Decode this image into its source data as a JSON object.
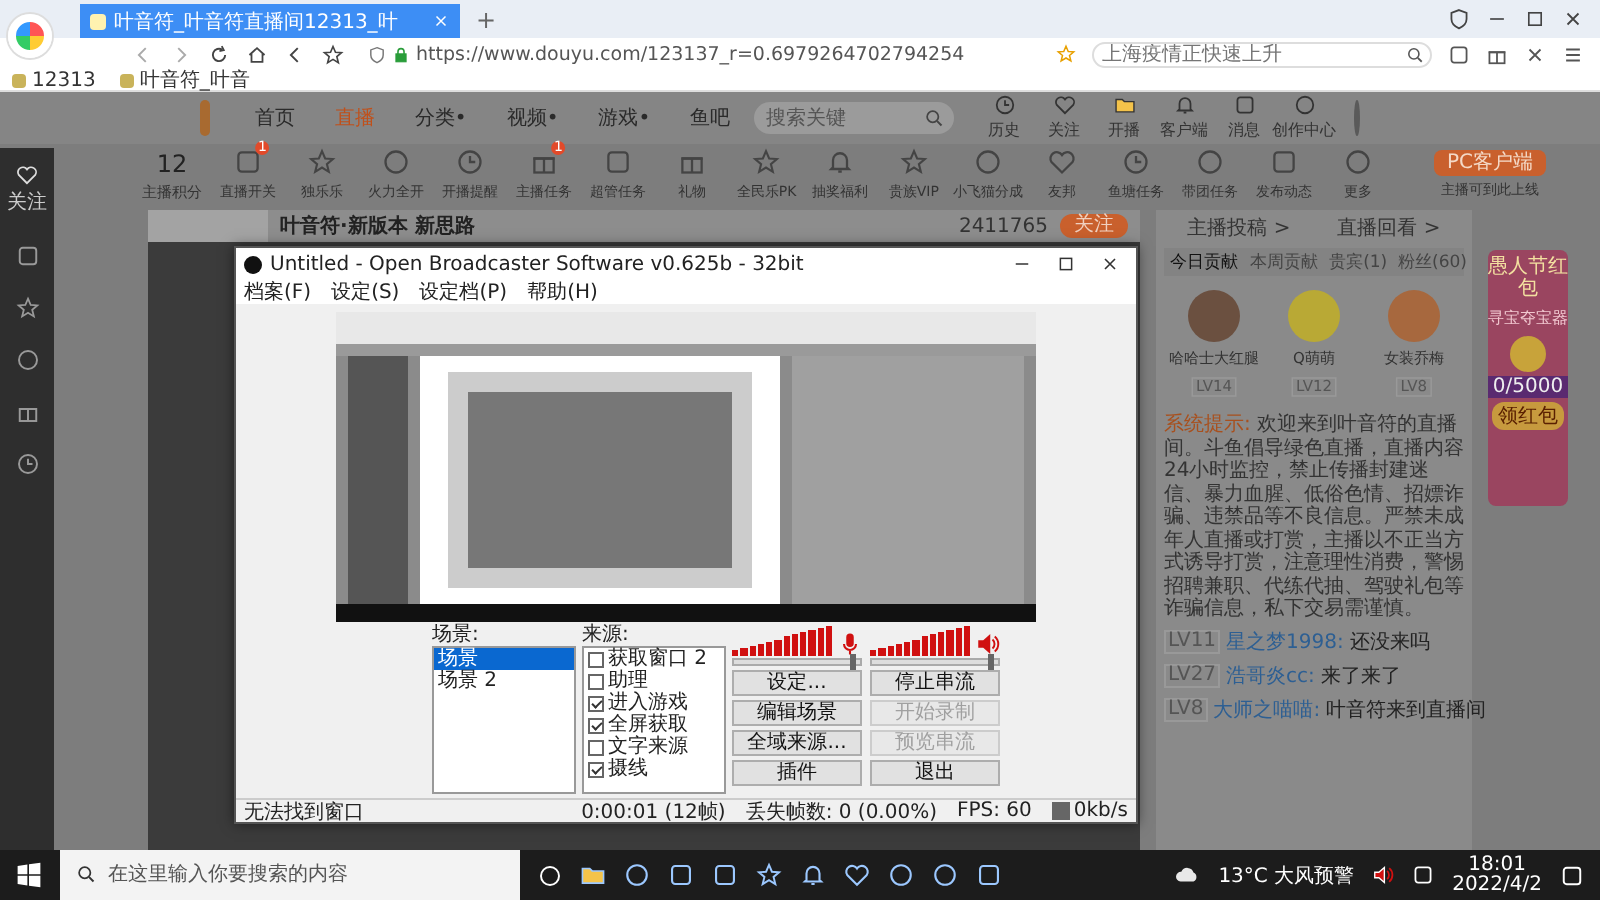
{
  "browser": {
    "tab_title": "叶音符_叶音符直播间12313_叶",
    "new_tab": "+",
    "url": "https://www.douyu.com/123137_r=0.6979264702794254",
    "search_placeholder": "上海疫情正快速上升",
    "bookmarks": [
      "12313",
      "叶音符_叶音"
    ]
  },
  "site": {
    "nav": [
      {
        "label": "首页",
        "selected": false
      },
      {
        "label": "直播",
        "selected": true
      },
      {
        "label": "分类•",
        "selected": false
      },
      {
        "label": "视频•",
        "selected": false
      },
      {
        "label": "游戏•",
        "selected": false
      },
      {
        "label": "鱼吧",
        "selected": false
      }
    ],
    "search_placeholder": "搜索关键",
    "top_icons": [
      "历史",
      "关注",
      "开播",
      "客户端",
      "消息",
      "创作中心"
    ],
    "score": {
      "value": "12",
      "label": "主播积分"
    },
    "tools": [
      {
        "label": "直播开关",
        "badge": "1"
      },
      {
        "label": "独乐乐"
      },
      {
        "label": "火力全开"
      },
      {
        "label": "开播提醒"
      },
      {
        "label": "主播任务",
        "badge": "1"
      },
      {
        "label": "超管任务"
      },
      {
        "label": "礼物"
      },
      {
        "label": "全民乐PK"
      },
      {
        "label": "抽奖福利"
      },
      {
        "label": "贵族VIP"
      },
      {
        "label": "小飞猫分成"
      },
      {
        "label": "友邦"
      },
      {
        "label": "鱼塘任务"
      },
      {
        "label": "带团任务"
      },
      {
        "label": "发布动态"
      },
      {
        "label": "更多"
      }
    ],
    "pc_client": "PC客户端",
    "pc_note": "主播可到此上线",
    "sidebar": [
      "关注"
    ],
    "streamer_title": "叶音符·新版本 新思路",
    "follow": "关注",
    "viewers": "2411765",
    "panel": {
      "links": [
        "主播投稿 >",
        "直播回看 >"
      ],
      "tabs": [
        {
          "label": "今日贡献",
          "selected": true
        },
        {
          "label": "本周贡献",
          "selected": false
        },
        {
          "label": "贵宾(1)",
          "selected": false
        },
        {
          "label": "粉丝(60)",
          "selected": false
        }
      ],
      "ranks": [
        {
          "name": "哈哈士大红腿",
          "level": "LV14"
        },
        {
          "name": "Q萌萌",
          "level": "LV12"
        },
        {
          "name": "女装乔梅",
          "level": "LV8"
        }
      ],
      "system_label": "系统提示:",
      "system_text": "欢迎来到叶音符的直播间。斗鱼倡导绿色直播，直播内容24小时监控，禁止传播封建迷信、暴力血腥、低俗色情、招嫖诈骗、违禁品等不良信息。严禁未成年人直播或打赏，主播以不正当方式诱导打赏，注意理性消费，警惕招聘兼职、代练代抽、驾驶礼包等诈骗信息，私下交易需谨慎。",
      "chat": [
        {
          "level": "LV11",
          "user": "星之梦1998:",
          "text": "还没来吗"
        },
        {
          "level": "LV27",
          "user": "浩哥炎cc:",
          "text": "来了来了"
        },
        {
          "level": "LV8",
          "user": "大师之喵喵:",
          "text": "叶音符来到直播间"
        }
      ],
      "promo": {
        "title": "愚人节红包",
        "subtitle": "寻宝夺宝器",
        "progress": "0/5000",
        "level": 0,
        "button": "领红包"
      }
    }
  },
  "obs": {
    "title": "Untitled - Open Broadcaster Software v0.625b - 32bit",
    "menu": [
      "档案(F)",
      "设定(S)",
      "设定档(P)",
      "帮助(H)"
    ],
    "scenes_label": "场景:",
    "scenes": [
      {
        "name": "场景",
        "selected": true
      },
      {
        "name": "场景 2",
        "selected": false
      }
    ],
    "sources_label": "来源:",
    "sources": [
      {
        "name": "获取窗口 2",
        "checked": false
      },
      {
        "name": "助理",
        "checked": false
      },
      {
        "name": "进入游戏",
        "checked": true
      },
      {
        "name": "全屏获取",
        "checked": true
      },
      {
        "name": "文字来源",
        "checked": false
      },
      {
        "name": "摄线",
        "checked": true
      }
    ],
    "meters": [
      {
        "kind": "mic",
        "level": 0.97
      },
      {
        "kind": "speaker",
        "level": 0.97
      }
    ],
    "buttons": [
      {
        "label": "设定...",
        "disabled": false
      },
      {
        "label": "停止串流",
        "disabled": false
      },
      {
        "label": "编辑场景",
        "disabled": false
      },
      {
        "label": "开始录制",
        "disabled": true
      },
      {
        "label": "全域来源...",
        "disabled": false
      },
      {
        "label": "预览串流",
        "disabled": true
      },
      {
        "label": "插件",
        "disabled": false
      },
      {
        "label": "退出",
        "disabled": false
      }
    ],
    "status": {
      "message": "无法找到窗口",
      "time": "0:00:01 (12帧)",
      "dropped": "丢失帧数: 0 (0.00%)",
      "fps": "FPS: 60",
      "bitrate": "0kb/s"
    }
  },
  "taskbar": {
    "search_placeholder": "在这里输入你要搜索的内容",
    "weather": "13°C 大风预警",
    "time": "18:01",
    "date": "2022/4/2"
  }
}
